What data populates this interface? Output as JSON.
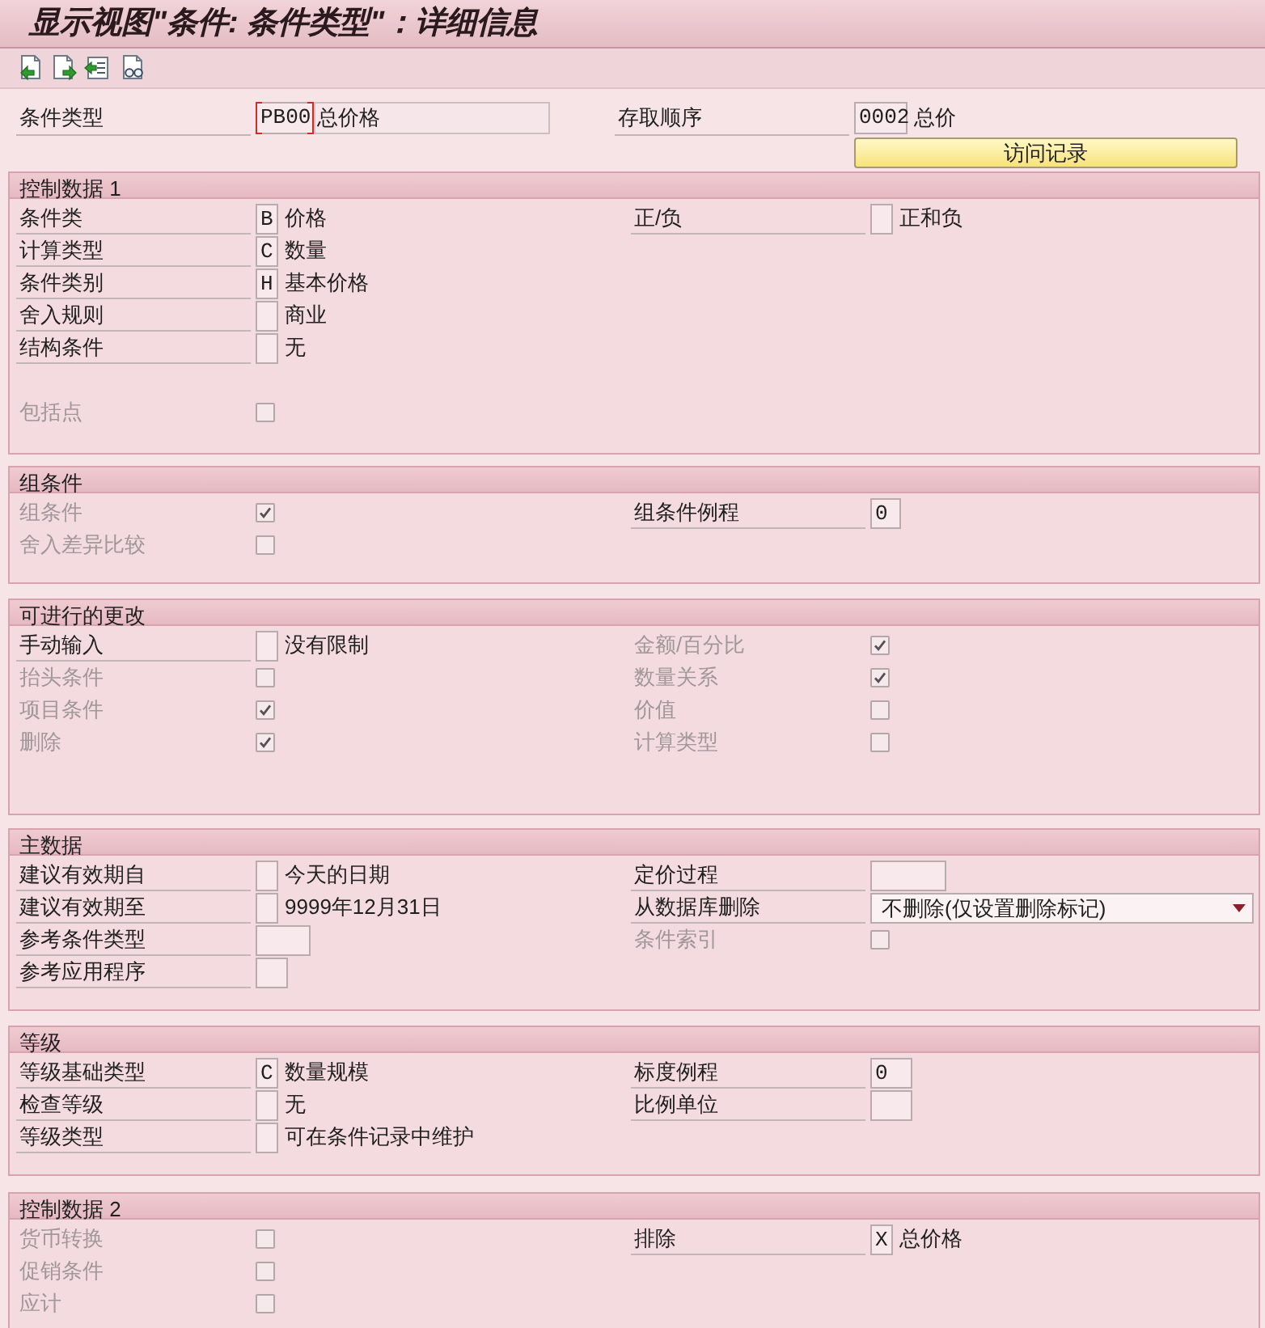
{
  "window": {
    "title": "显示视图\"条件: 条件类型\"：详细信息"
  },
  "header": {
    "fields": [
      {
        "label": "条件类型",
        "value": "PB00",
        "description": "总价格",
        "focused": true
      },
      {
        "label": "存取顺序",
        "value": "0002",
        "description": "总价",
        "focused": false
      }
    ],
    "button": "访问记录"
  },
  "sections": [
    {
      "title": "控制数据 1",
      "left": [
        [
          {
            "kind": "field",
            "label": "条件类",
            "value": "B",
            "description": "价格",
            "disabled": false
          },
          {
            "kind": "field",
            "label": "计算类型",
            "value": "C",
            "description": "数量",
            "disabled": false
          },
          {
            "kind": "field",
            "label": "条件类别",
            "value": "H",
            "description": "基本价格",
            "disabled": false
          },
          {
            "kind": "field",
            "label": "舍入规则",
            "description": "商业",
            "disabled": false
          },
          {
            "kind": "field",
            "label": "结构条件",
            "description": "无",
            "disabled": false
          }
        ],
        [
          {
            "kind": "checkbox",
            "label": "包括点",
            "checked": false,
            "disabled": true
          }
        ]
      ],
      "right": [
        [
          {
            "kind": "field",
            "label": "正/负",
            "description": "正和负",
            "disabled": false
          }
        ]
      ]
    },
    {
      "title": "组条件",
      "left": [
        [
          {
            "kind": "checkbox",
            "label": "组条件",
            "checked": true,
            "disabled": true
          },
          {
            "kind": "checkbox",
            "label": "舍入差异比较",
            "checked": false,
            "disabled": true
          }
        ]
      ],
      "right": [
        [
          {
            "kind": "field",
            "label": "组条件例程",
            "value": "0",
            "disabled": false
          }
        ]
      ]
    },
    {
      "title": "可进行的更改",
      "left": [
        [
          {
            "kind": "field",
            "label": "手动输入",
            "description": "没有限制",
            "disabled": false
          },
          {
            "kind": "checkbox",
            "label": "抬头条件",
            "checked": false,
            "disabled": true
          },
          {
            "kind": "checkbox",
            "label": "项目条件",
            "checked": true,
            "disabled": true
          },
          {
            "kind": "checkbox",
            "label": "删除",
            "checked": true,
            "disabled": true
          }
        ]
      ],
      "right": [
        [
          {
            "kind": "checkbox",
            "label": "金额/百分比",
            "checked": true,
            "disabled": true
          },
          {
            "kind": "checkbox",
            "label": "数量关系",
            "checked": true,
            "disabled": true
          },
          {
            "kind": "checkbox",
            "label": "价值",
            "checked": false,
            "disabled": true
          },
          {
            "kind": "checkbox",
            "label": "计算类型",
            "checked": false,
            "disabled": true
          }
        ]
      ]
    },
    {
      "title": "主数据",
      "left": [
        [
          {
            "kind": "field",
            "label": "建议有效期自",
            "description": "今天的日期",
            "disabled": false
          },
          {
            "kind": "field",
            "label": "建议有效期至",
            "description": "9999年12月31日",
            "disabled": false
          },
          {
            "kind": "field",
            "label": "参考条件类型",
            "disabled": false
          },
          {
            "kind": "field",
            "label": "参考应用程序",
            "disabled": false
          }
        ]
      ],
      "right": [
        [
          {
            "kind": "field",
            "label": "定价过程",
            "disabled": false
          },
          {
            "kind": "dropdown",
            "label": "从数据库删除",
            "value": "不删除(仅设置删除标记)",
            "disabled": false
          },
          {
            "kind": "checkbox",
            "label": "条件索引",
            "checked": false,
            "disabled": true
          }
        ]
      ]
    },
    {
      "title": "等级",
      "left": [
        [
          {
            "kind": "field",
            "label": "等级基础类型",
            "value": "C",
            "description": "数量规模",
            "disabled": false
          },
          {
            "kind": "field",
            "label": "检查等级",
            "description": "无",
            "disabled": false
          },
          {
            "kind": "field",
            "label": "等级类型",
            "description": "可在条件记录中维护",
            "disabled": false
          }
        ]
      ],
      "right": [
        [
          {
            "kind": "field",
            "label": "标度例程",
            "value": "0",
            "disabled": false
          },
          {
            "kind": "field",
            "label": "比例单位",
            "disabled": false
          }
        ]
      ]
    },
    {
      "title": "控制数据 2",
      "left": [
        [
          {
            "kind": "checkbox",
            "label": "货币转换",
            "checked": false,
            "disabled": true
          },
          {
            "kind": "checkbox",
            "label": "促销条件",
            "checked": false,
            "disabled": true
          },
          {
            "kind": "checkbox",
            "label": "应计",
            "checked": false,
            "disabled": true
          }
        ]
      ],
      "right": [
        [
          {
            "kind": "field",
            "label": "排除",
            "value": "X",
            "description": "总价格",
            "disabled": false
          }
        ]
      ]
    }
  ]
}
